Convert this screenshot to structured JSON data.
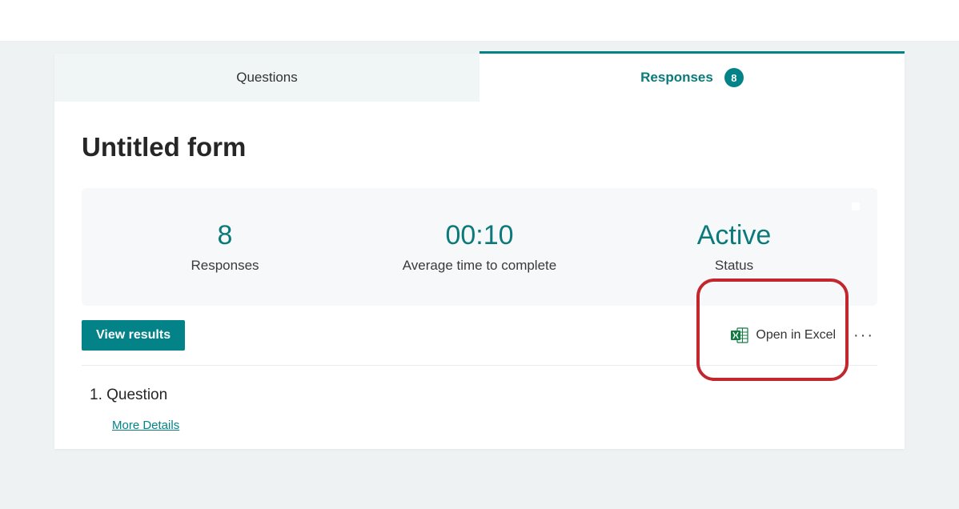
{
  "tabs": {
    "questions_label": "Questions",
    "responses_label": "Responses",
    "responses_count": "8"
  },
  "form": {
    "title": "Untitled form"
  },
  "stats": {
    "responses_value": "8",
    "responses_label": "Responses",
    "avg_time_value": "00:10",
    "avg_time_label": "Average time to complete",
    "status_value": "Active",
    "status_label": "Status"
  },
  "actions": {
    "view_results": "View results",
    "open_excel": "Open in Excel",
    "more": "···"
  },
  "question": {
    "number": "1.",
    "text": "Question",
    "more_details": "More Details"
  }
}
